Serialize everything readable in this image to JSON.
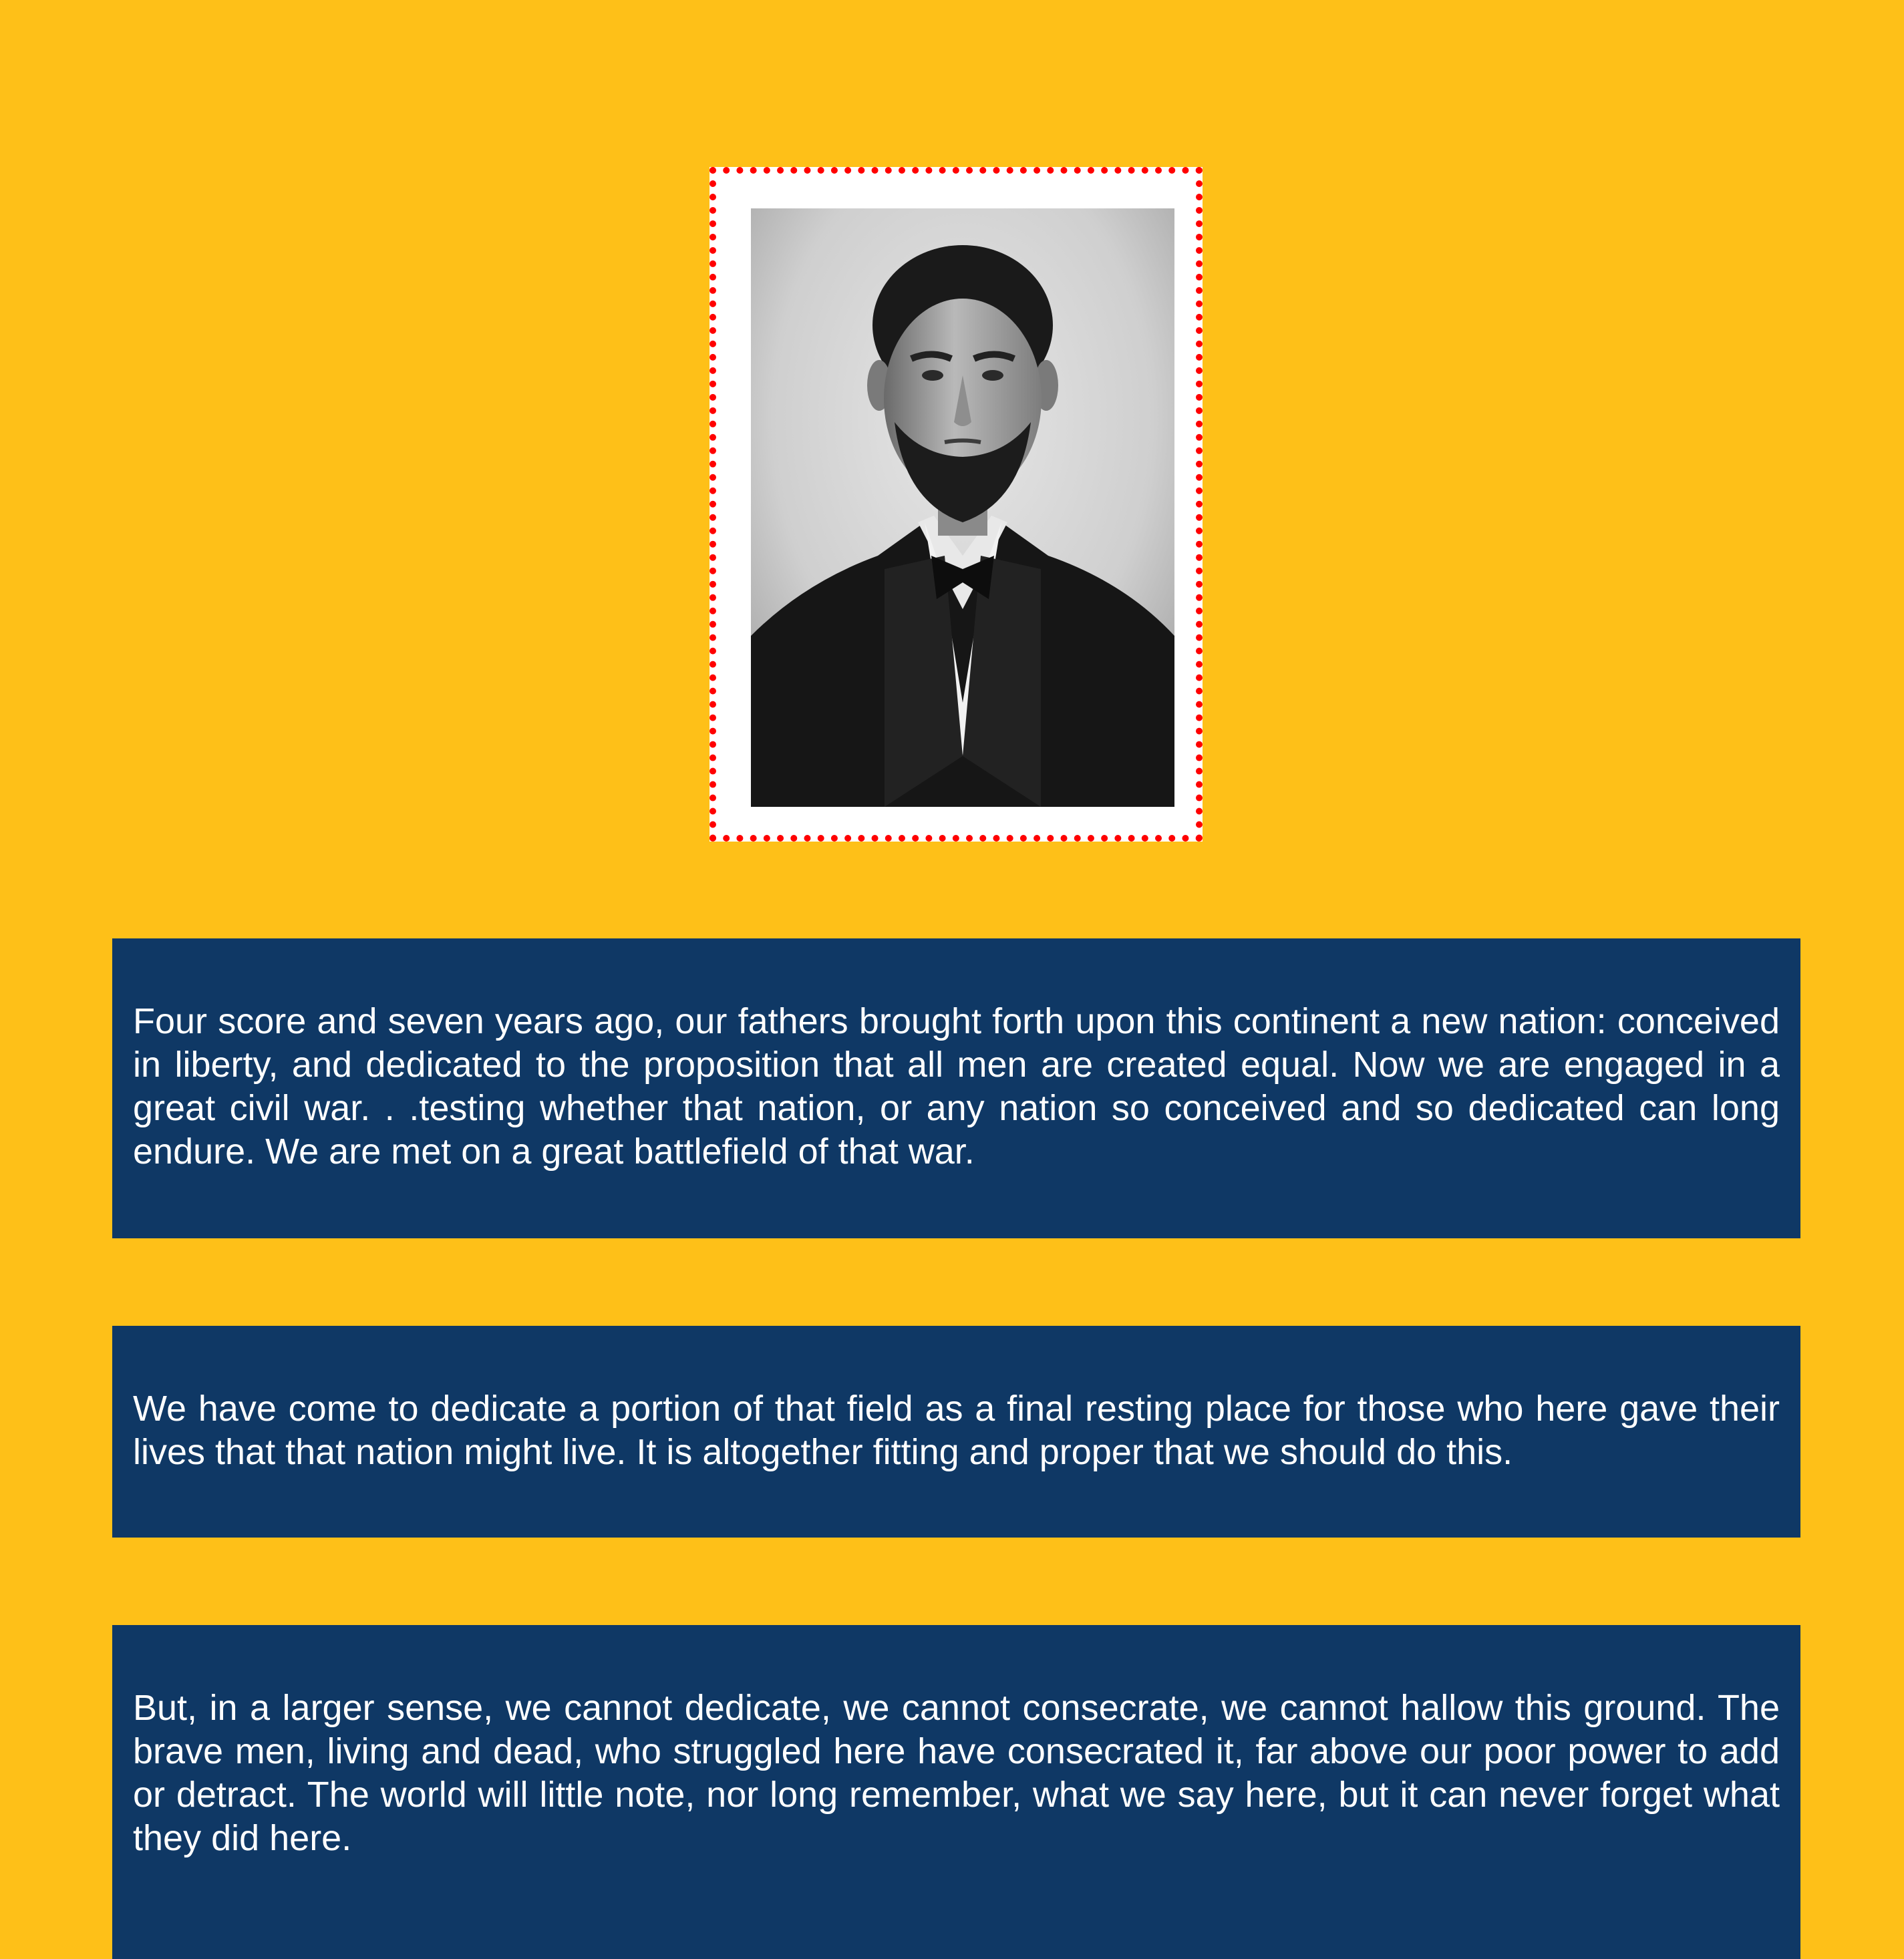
{
  "portrait": {
    "icon": "portrait-photo"
  },
  "paragraphs": [
    "Four score and seven years ago, our fathers brought forth upon this continent a new nation: conceived in liberty, and dedicated to the proposition that all men are created equal. Now we are engaged in a great civil war. . .testing whether that nation, or any nation so conceived and so dedicated can long endure. We are met on a great battlefield of that war.",
    "We have come to dedicate a portion of that field as a final resting place for those who here gave their lives that that nation might live. It is altogether fitting and proper that we should do this.",
    "But, in a larger sense, we cannot dedicate, we cannot consecrate, we cannot hallow this ground. The brave men, living and dead, who struggled here have consecrated it, far above our poor power to add or detract. The world will little note, nor long remember, what we say here, but it can never forget what they did here."
  ],
  "colors": {
    "background": "#FEC018",
    "panel": "#0F3865",
    "panel_text": "#FFFFFF",
    "frame_border": "#FF0000",
    "frame_fill": "#FFFFFF"
  }
}
